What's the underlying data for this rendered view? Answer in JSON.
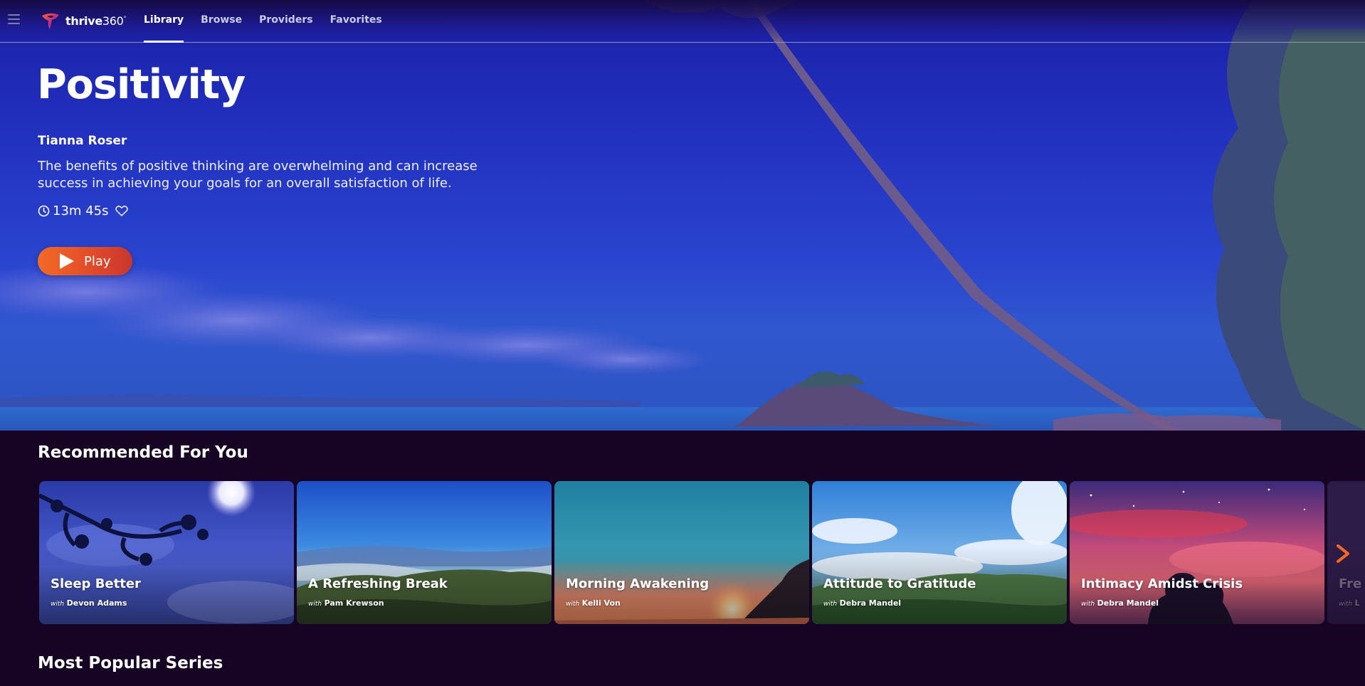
{
  "nav": {
    "brand_main": "thrive",
    "brand_num": "360",
    "brand_mark": "°",
    "links": [
      "Library",
      "Browse",
      "Providers",
      "Favorites"
    ],
    "active": "Library"
  },
  "hero": {
    "title": "Positivity",
    "author": "Tianna Roser",
    "description": "The benefits of positive thinking are overwhelming and can increase success in achieving your goals for an overall satisfaction of life.",
    "duration": "13m 45s",
    "play_label": "Play"
  },
  "recommended": {
    "title": "Recommended For You",
    "cards": [
      {
        "title": "Sleep Better",
        "with": "with",
        "author": "Devon Adams"
      },
      {
        "title": "A Refreshing Break",
        "with": "with",
        "author": "Pam Krewson"
      },
      {
        "title": "Morning Awakening",
        "with": "with",
        "author": "Kelli Von"
      },
      {
        "title": "Attitude to Gratitude",
        "with": "with",
        "author": "Debra Mandel"
      },
      {
        "title": "Intimacy Amidst Crisis",
        "with": "with",
        "author": "Debra Mandel"
      },
      {
        "title": "Fre",
        "with": "with",
        "author": "L"
      }
    ]
  },
  "popular": {
    "title": "Most Popular Series"
  },
  "colors": {
    "background": "#170425",
    "accent": "#f36a25",
    "hero_blue": "#2333c2"
  },
  "icons": {
    "menu": "hamburger-icon",
    "logo": "thrive360-logo-icon",
    "clock": "clock-icon",
    "heart": "heart-icon",
    "play": "play-icon",
    "next": "chevron-right-icon"
  }
}
